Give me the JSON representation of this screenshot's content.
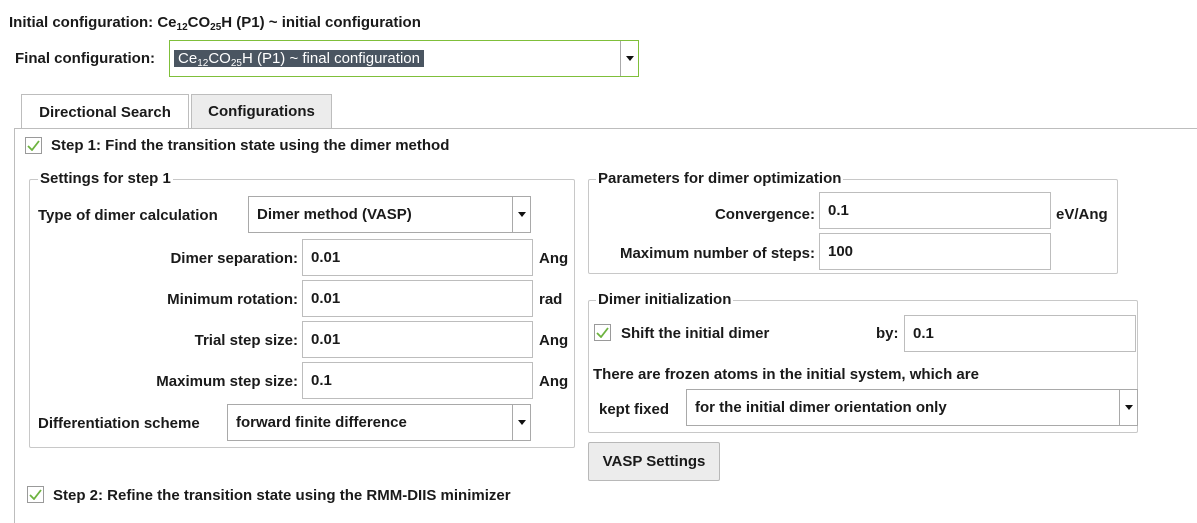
{
  "header": {
    "initial_label": "Initial configuration:",
    "initial_formula": [
      "Ce",
      "12",
      "CO",
      "25",
      "H"
    ],
    "initial_suffix": " (P1) ~ initial configuration",
    "final_label": "Final configuration:",
    "final_formula": [
      "Ce",
      "12",
      "CO",
      "25",
      "H"
    ],
    "final_suffix": " (P1) ~ final configuration"
  },
  "tabs": [
    {
      "label": "Directional Search",
      "active": true
    },
    {
      "label": "Configurations",
      "active": false
    }
  ],
  "step1": {
    "label": "Step 1: Find the transition state using the dimer method",
    "checked": true
  },
  "settings": {
    "title": "Settings for step 1",
    "type_label": "Type of dimer calculation",
    "type_value": "Dimer method (VASP)",
    "separation_label": "Dimer separation:",
    "separation_value": "0.01",
    "separation_unit": "Ang",
    "rotation_label": "Minimum rotation:",
    "rotation_value": "0.01",
    "rotation_unit": "rad",
    "trial_label": "Trial step size:",
    "trial_value": "0.01",
    "trial_unit": "Ang",
    "max_step_label": "Maximum step size:",
    "max_step_value": "0.1",
    "max_step_unit": "Ang",
    "diff_label": "Differentiation scheme",
    "diff_value": "forward finite difference"
  },
  "params": {
    "title": "Parameters for dimer optimization",
    "convergence_label": "Convergence:",
    "convergence_value": "0.1",
    "convergence_unit": "eV/Ang",
    "max_steps_label": "Maximum number of steps:",
    "max_steps_value": "100"
  },
  "init": {
    "title": "Dimer initialization",
    "shift_label": "Shift the initial dimer",
    "shift_checked": true,
    "by_label": "by:",
    "by_value": "0.1",
    "frozen_text": "There are frozen atoms in the initial system, which are",
    "kept_label": "kept fixed",
    "kept_value": "for the initial dimer orientation only"
  },
  "vasp_button": "VASP Settings",
  "step2": {
    "label": "Step 2: Refine the transition state using the RMM-DIIS minimizer",
    "checked": true
  },
  "colors": {
    "check": "#6db33f",
    "final_combo_border": "#7fbf3a",
    "selection_bg": "#4a5561",
    "tab_bg": "#ececec"
  }
}
